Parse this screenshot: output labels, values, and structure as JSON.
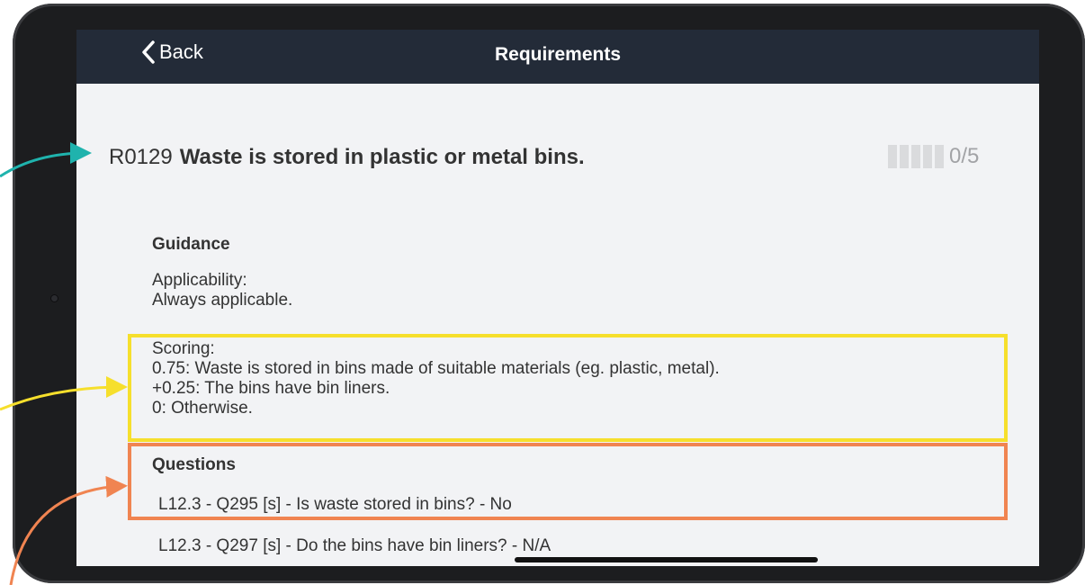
{
  "colors": {
    "navbar": "#232b38",
    "screen_bg": "#f2f3f5",
    "highlight_yellow": "#f6df2c",
    "highlight_orange": "#f08451",
    "arrow_teal": "#1fb3ad",
    "text": "#333333",
    "muted": "#a2a3a6"
  },
  "navbar": {
    "back_label": "Back",
    "back_icon": "chevron-left-icon",
    "title": "Requirements"
  },
  "requirement": {
    "code": "R0129",
    "title": "Waste is stored in plastic or metal bins.",
    "score_text": "0/5",
    "score_filled": 0,
    "score_total": 5
  },
  "guidance": {
    "heading": "Guidance",
    "applicability_label": "Applicability:",
    "applicability_text": "Always applicable.",
    "scoring_label": "Scoring:",
    "scoring_lines": [
      "0.75: Waste is stored in bins made of suitable materials (eg. plastic, metal).",
      "+0.25: The bins have bin liners.",
      "0: Otherwise."
    ]
  },
  "questions": {
    "heading": "Questions",
    "items": [
      "L12.3 - Q295 [s] - Is waste stored in bins? - No",
      "L12.3 - Q297 [s] - Do the bins have bin liners? - N/A"
    ]
  }
}
